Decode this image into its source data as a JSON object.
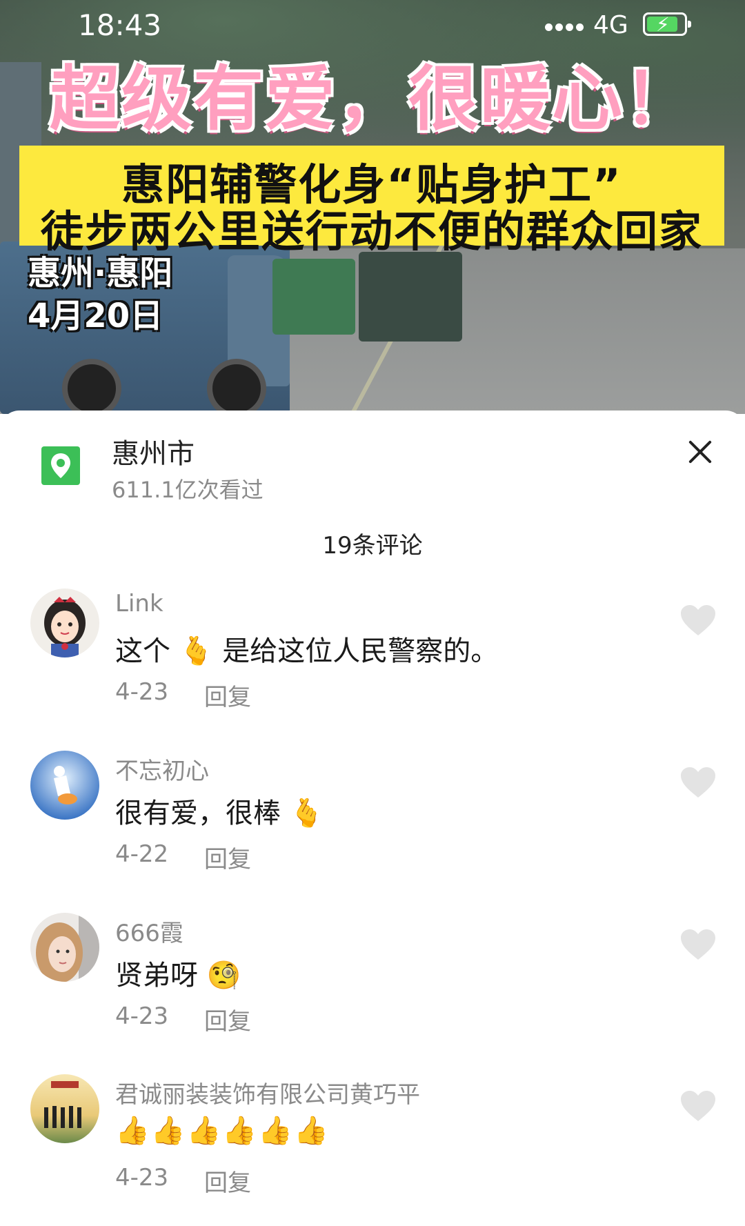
{
  "status_bar": {
    "time": "18:43",
    "network": "4G",
    "battery_icon": "battery-charging-icon"
  },
  "video": {
    "headline": "超级有爱，很暖心！",
    "banner_line1": "惠阳辅警化身“贴身护工”",
    "banner_line2": "徒步两公里送行动不便的群众回家",
    "place": "惠州·惠阳",
    "date": "4月20日"
  },
  "location": {
    "name": "惠州市",
    "views": "611.1亿次看过",
    "icon": "location-pin-icon"
  },
  "comments_header": {
    "count_label": "19条评论"
  },
  "comments": [
    {
      "user": "Link",
      "text": "这个",
      "emoji": "🫰",
      "text_after": "是给这位人民警察的。",
      "date": "4-23",
      "reply": "回复"
    },
    {
      "user": "不忘初心",
      "text": "很有爱，很棒",
      "emoji": "🫰",
      "text_after": "",
      "date": "4-22",
      "reply": "回复"
    },
    {
      "user": "666霞",
      "text": "贤弟呀",
      "emoji": "🧐",
      "text_after": "",
      "date": "4-23",
      "reply": "回复"
    },
    {
      "user": "君诚丽装装饰有限公司黄巧平",
      "text": "",
      "emoji": "👍👍👍👍👍👍",
      "text_after": "",
      "date": "4-23",
      "reply": "回复"
    }
  ],
  "colors": {
    "accent_green": "#3cbf57",
    "headline_pink": "#ff9fbf",
    "banner_yellow": "#fde93e",
    "muted_text": "#8a8a8a",
    "heart_gray": "#e3e3e3"
  }
}
